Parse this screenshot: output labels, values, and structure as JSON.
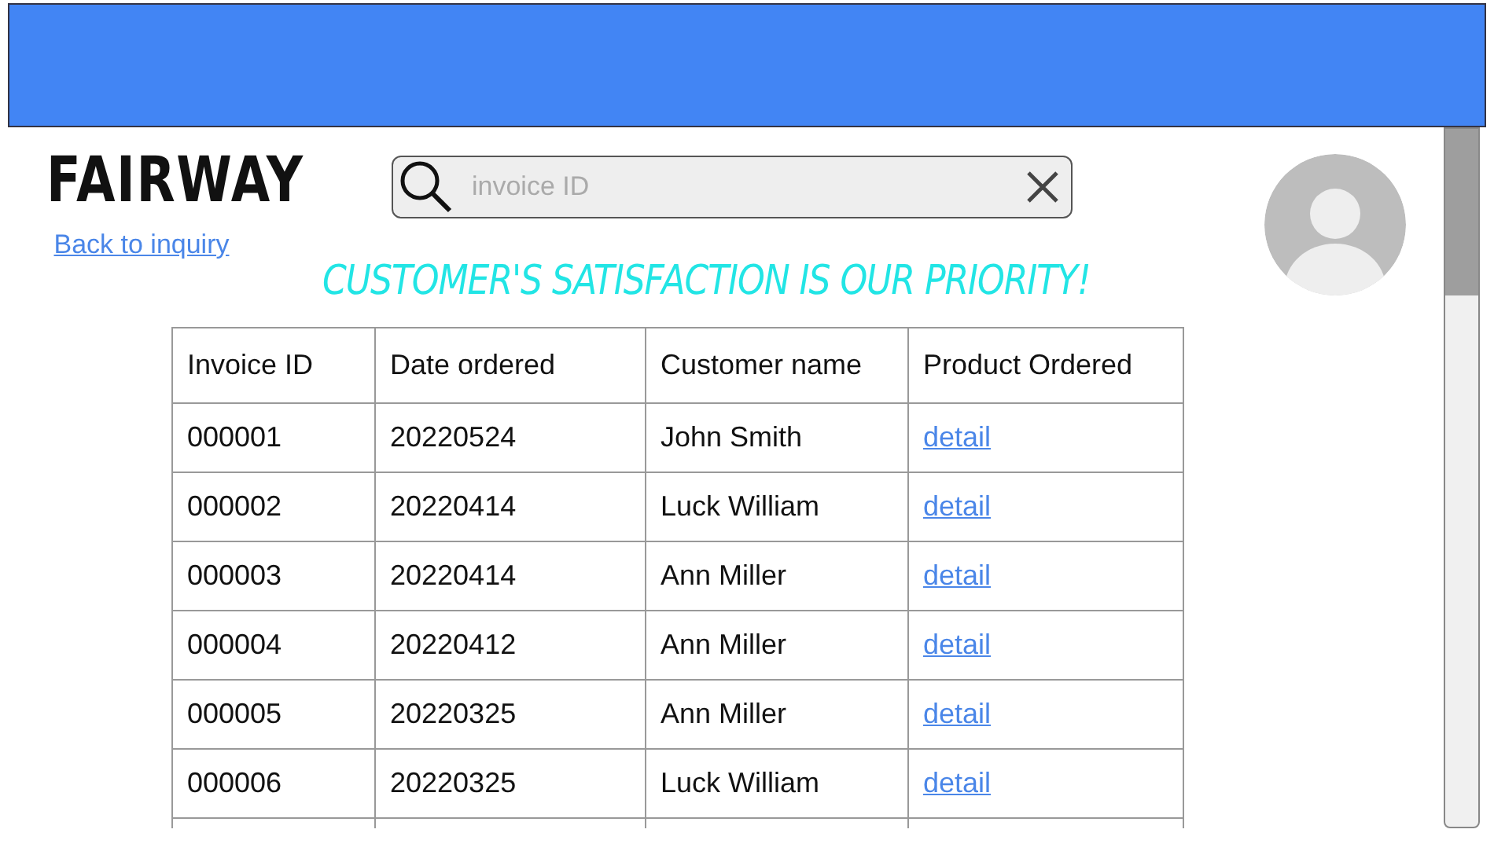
{
  "logo": "FAIRWAY",
  "back_link": "Back to inquiry",
  "search": {
    "placeholder": "invoice ID"
  },
  "slogan": "CUSTOMER'S SATISFACTION IS OUR PRIORITY!",
  "table": {
    "columns": [
      "Invoice ID",
      "Date ordered",
      "Customer name",
      "Product Ordered"
    ],
    "rows": [
      {
        "invoice_id": "000001",
        "date": "20220524",
        "customer": "John Smith",
        "product": "detail"
      },
      {
        "invoice_id": "000002",
        "date": "20220414",
        "customer": "Luck William",
        "product": "detail"
      },
      {
        "invoice_id": "000003",
        "date": "20220414",
        "customer": "Ann Miller",
        "product": "detail"
      },
      {
        "invoice_id": "000004",
        "date": "20220412",
        "customer": "Ann Miller",
        "product": "detail"
      },
      {
        "invoice_id": "000005",
        "date": "20220325",
        "customer": "Ann Miller",
        "product": "detail"
      },
      {
        "invoice_id": "000006",
        "date": "20220325",
        "customer": "Luck William",
        "product": "detail"
      }
    ]
  }
}
